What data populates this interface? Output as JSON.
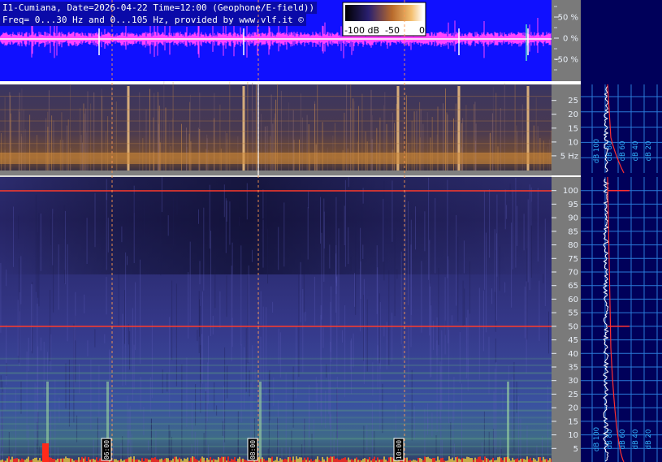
{
  "header": {
    "line1": "I1-Cumiana, Date=2026-04-22 Time=12:00 (Geophone/E-field))",
    "line2": "Freq= 0...30 Hz and 0...105 Hz, provided by www.vlf.it ©"
  },
  "colorbar": {
    "labels": [
      "-100 dB",
      "-50",
      "0"
    ],
    "colors": [
      "#000000",
      "#3a2a8a",
      "#c77a2a",
      "#f4c070",
      "#ffffff"
    ]
  },
  "waveform": {
    "pct_labels": [
      "50 %",
      "0 %",
      "-50 %"
    ],
    "bg_color": "#1010ff",
    "trace_color": "#ff44ff"
  },
  "spectrogram_low": {
    "freq_ticks": [
      "25",
      "20",
      "15",
      "10",
      "5 Hz"
    ],
    "db_labels": [
      "dB 100",
      "dB 80",
      "dB 60",
      "dB 40",
      "dB 20"
    ]
  },
  "spectrogram_high": {
    "freq_ticks": [
      "100",
      "95",
      "90",
      "85",
      "80",
      "75",
      "70",
      "65",
      "60",
      "55",
      "50",
      "45",
      "40",
      "35",
      "30",
      "25",
      "20",
      "15",
      "10",
      "5"
    ],
    "db_labels": [
      "dB 100",
      "dB 80",
      "dB 60",
      "dB 40",
      "dB 20"
    ],
    "line_freqs_hz": [
      100,
      50
    ]
  },
  "time_markers": [
    "06:00",
    "08:00",
    "10:00"
  ],
  "colors": {
    "grid": "#ff9a50",
    "ticks_panel": "#7a7a7a",
    "profile_panel": "#00005a",
    "profile_grid": "#2a7ad8"
  }
}
